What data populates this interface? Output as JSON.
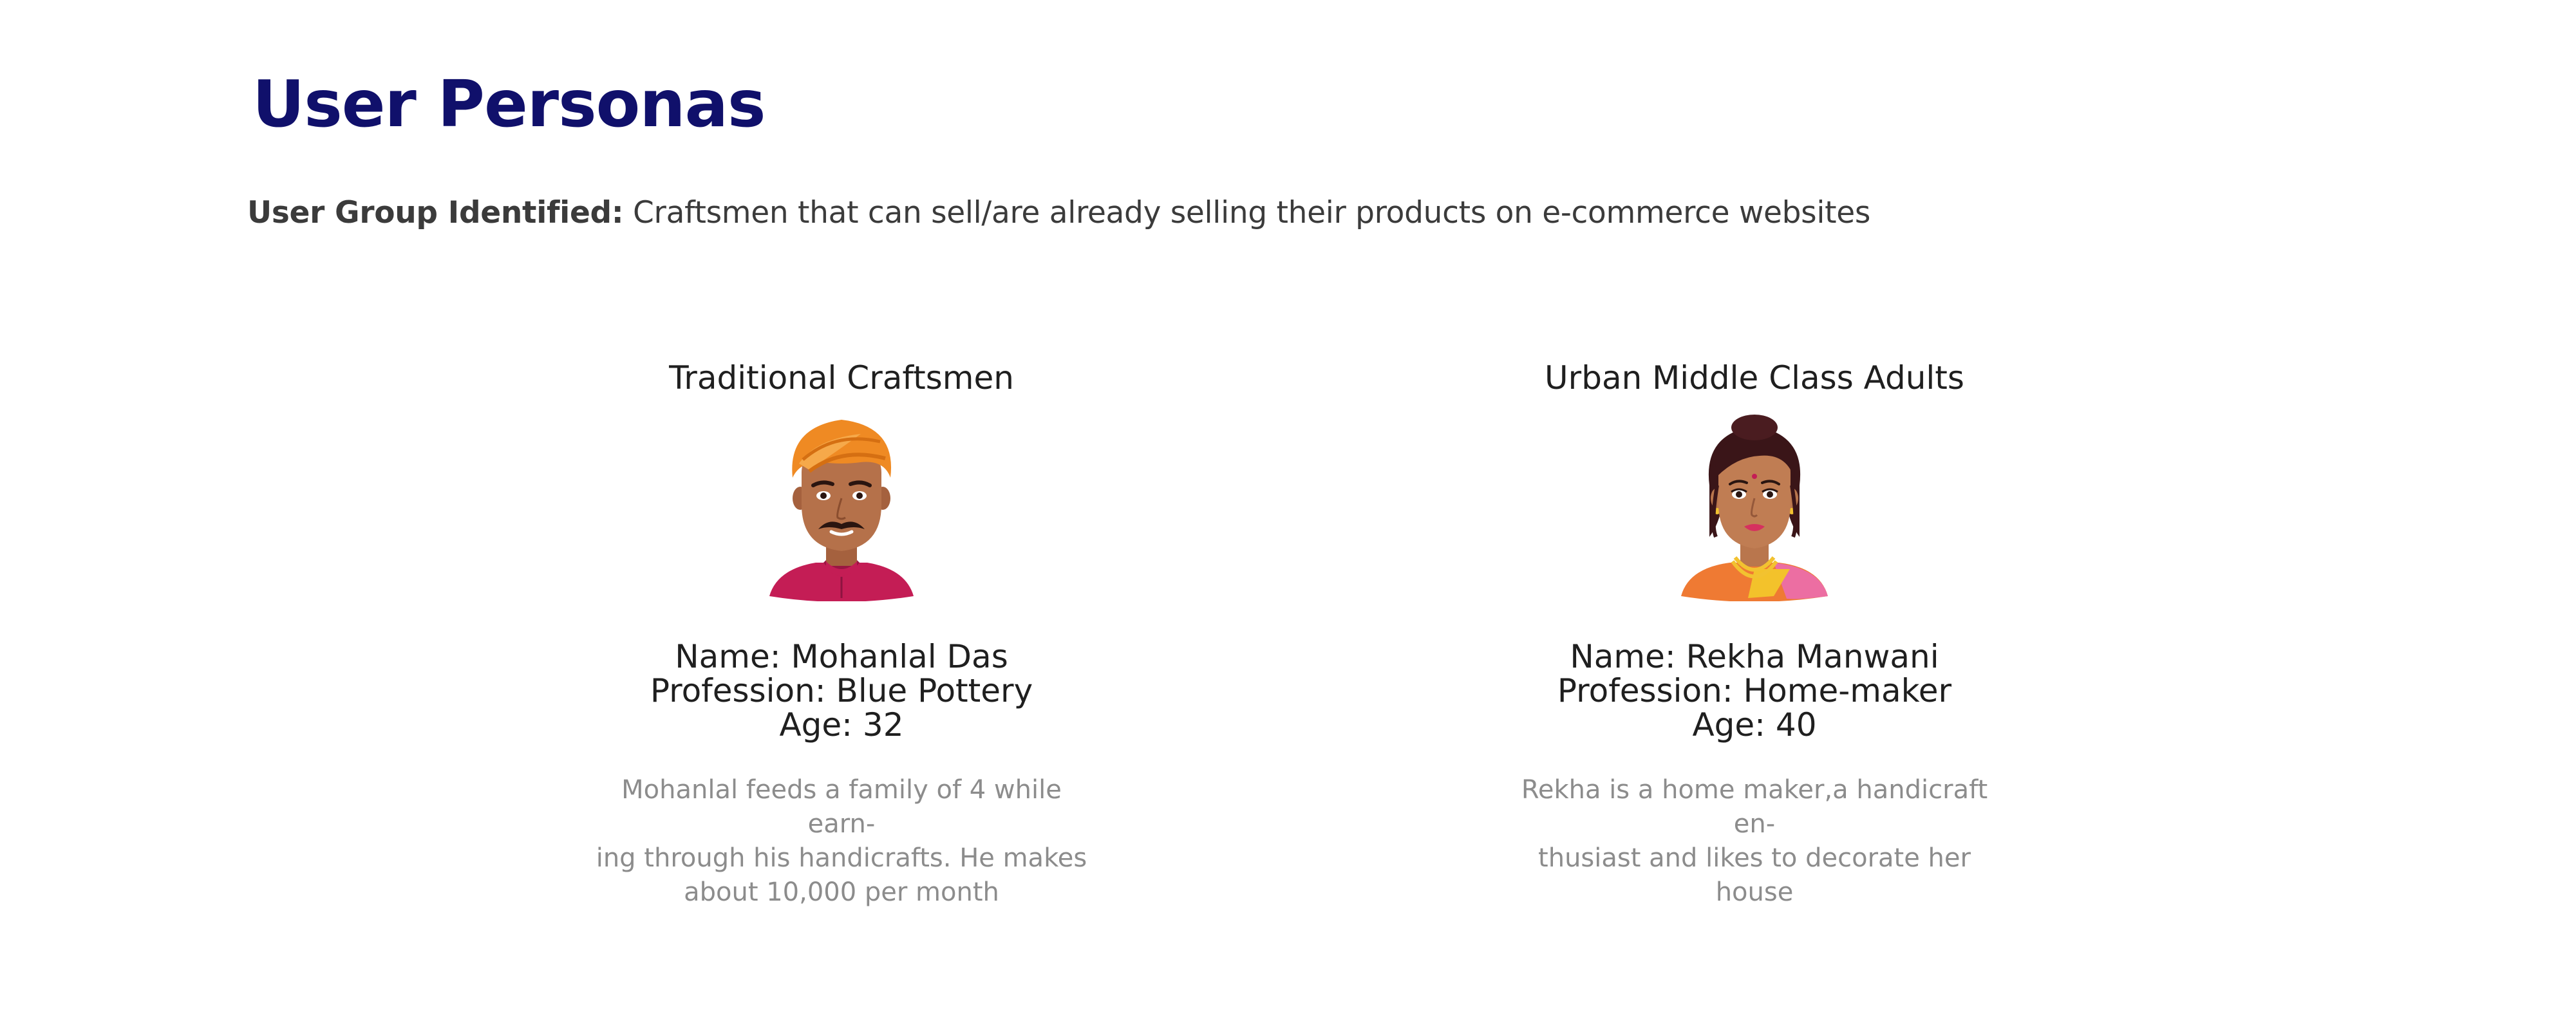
{
  "page": {
    "title": "User Personas",
    "user_group_label": "User Group Identified:",
    "user_group_text": " Craftsmen that can sell/are already selling their products on e-commerce websites"
  },
  "personas": [
    {
      "title": "Traditional Craftsmen",
      "avatar": "male-craftsman-turban-avatar",
      "name_line": "Name: Mohanlal Das",
      "profession_line": "Profession: Blue Pottery",
      "age_line": "Age: 32",
      "description_lines": [
        "Mohanlal feeds a family of 4 while earn-",
        "ing through his handicrafts. He makes",
        "about 10,000 per month"
      ]
    },
    {
      "title": "Urban Middle Class Adults",
      "avatar": "female-homemaker-avatar",
      "name_line": "Name: Rekha Manwani",
      "profession_line": "Profession: Home-maker",
      "age_line": "Age: 40",
      "description_lines": [
        "Rekha is a home maker,a handicraft en-",
        "thusiast and likes to decorate her house"
      ]
    }
  ],
  "colors": {
    "title": "#10106b",
    "body_text": "#3b3b3b",
    "persona_text": "#1f1f1f",
    "description_text": "#8c8c8c",
    "turban": "#ef8a23",
    "kurta": "#c41d55",
    "skin": "#b5714a",
    "hair": "#3a1518",
    "saree": "#ef7a33"
  }
}
